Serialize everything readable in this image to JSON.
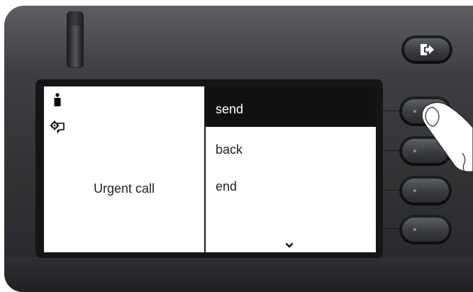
{
  "display": {
    "call_label": "Urgent call",
    "menu": [
      {
        "label": "send",
        "selected": true
      },
      {
        "label": "back",
        "selected": false
      },
      {
        "label": "end",
        "selected": false
      }
    ]
  },
  "icons": {
    "status_top": "person-icon",
    "status_bottom": "voicemail-settings-icon",
    "scroll": "chevron-down-icon",
    "exit_key": "exit-arrow-icon"
  },
  "colors": {
    "selection": "#111111",
    "screen": "#ffffff",
    "housing": "#3a3c3f"
  }
}
